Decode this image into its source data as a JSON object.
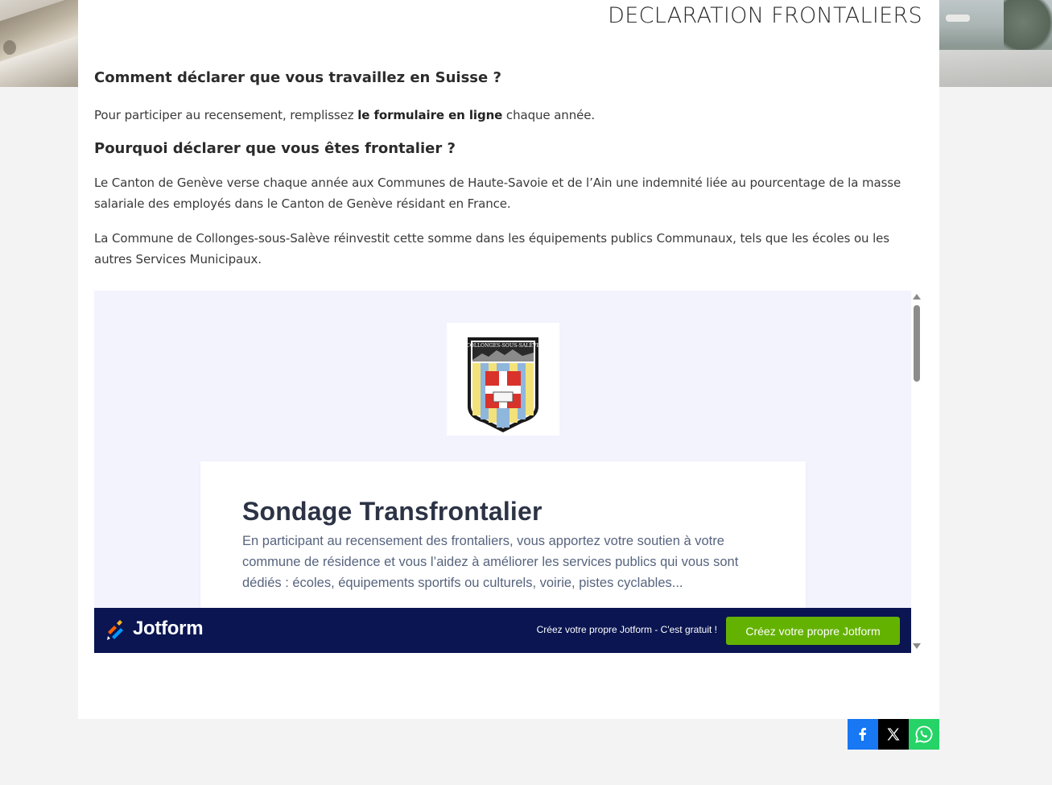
{
  "header": {
    "title": "DECLARATION FRONTALIERS"
  },
  "article": {
    "q1_heading": "Comment déclarer que vous travaillez en Suisse ?",
    "q1_text_before": "Pour participer au recensement, remplissez ",
    "q1_link": "le formulaire en ligne",
    "q1_text_after": " chaque année.",
    "q2_heading": "Pourquoi déclarer que vous êtes frontalier ?",
    "q2_para1": "Le Canton de Genève verse chaque année aux Communes de Haute-Savoie et de l’Ain une indemnité liée au pourcentage de la masse salariale des employés dans le Canton de Genève résidant en France.",
    "q2_para2": "La Commune de Collonges-sous-Salève réinvestit cette somme dans les équipements publics Communaux, tels que les écoles ou les autres Services Municipaux."
  },
  "form": {
    "logo_text": "COLLONGES-SOUS-SALÈVE",
    "title": "Sondage Transfrontalier",
    "description": "En participant au recensement des frontaliers, vous apportez votre soutien à votre commune de résidence et vous l’aidez à améliorer les services publics qui vous sont dédiés : écoles, équipements sportifs ou culturels, voirie, pistes cyclables..."
  },
  "jotform_bar": {
    "brand": "Jotform",
    "promo": "Créez votre propre Jotform - C'est gratuit !",
    "button": "Créez votre propre Jotform"
  },
  "share": {
    "colors": {
      "facebook": "#1877f2",
      "x": "#000000",
      "whatsapp": "#25d366"
    },
    "icons": [
      "facebook-icon",
      "x-icon",
      "whatsapp-icon"
    ]
  },
  "colors": {
    "jotform_bar": "#0a1551",
    "jotform_button": "#64b200",
    "form_background": "#f3f3fe"
  }
}
